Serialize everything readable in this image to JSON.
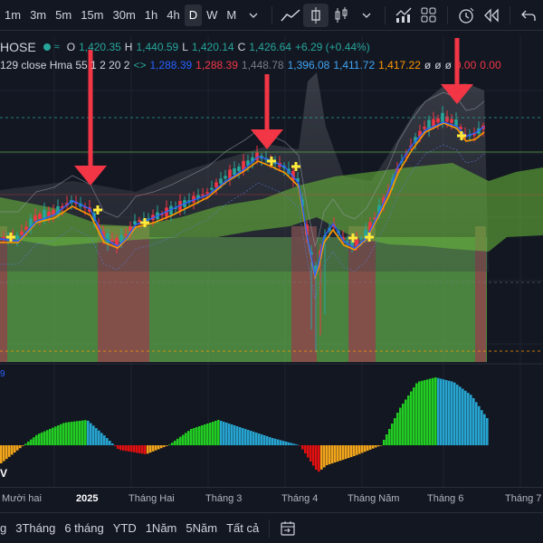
{
  "toolbar": {
    "timeframes": [
      "1m",
      "3m",
      "5m",
      "15m",
      "30m",
      "1h",
      "4h",
      "D",
      "W",
      "M"
    ],
    "active_timeframe": "D",
    "icons": [
      "chevron-down-icon",
      "line-chart-icon",
      "candle-chart-icon",
      "chevron-down-icon",
      "indicators-icon",
      "templates-icon",
      "alert-icon",
      "replay-icon",
      "undo-icon"
    ]
  },
  "legend": {
    "symbol": "HOSE",
    "open_label": "O",
    "open": "1,420.35",
    "high_label": "H",
    "high": "1,440.59",
    "low_label": "L",
    "low": "1,420.14",
    "close_label": "C",
    "close": "1,426.64",
    "change": "+6.29 (+0.44%)",
    "indicator_name": "129 close Hma 55 1 2 20 2",
    "ind_v1": "1,288.39",
    "ind_v2": "1,288.39",
    "ind_v3": "1,448.78",
    "ind_v4": "1,396.08",
    "ind_v5": "1,411.72",
    "ind_v6": "1,417.22",
    "ind_v7": "ø",
    "ind_v8": "ø",
    "ind_v9": "ø",
    "ind_v10": "0.00",
    "ind_v11": "0.00"
  },
  "oscillator": {
    "label": "9",
    "label2": "V"
  },
  "time_axis": [
    "Mười hai",
    "2025",
    "Tháng Hai",
    "Tháng 3",
    "Tháng 4",
    "Tháng Năm",
    "Tháng 6",
    "Tháng 7"
  ],
  "range_bar": [
    "3Tháng",
    "6 tháng",
    "YTD",
    "1Năm",
    "5Năm",
    "Tất cả"
  ],
  "range_bar_first": "g",
  "colors": {
    "background": "#131722",
    "up_candle": "#26a69a",
    "down_candle": "#f23645",
    "cloud_green": "#6bbf3a",
    "arrow_red": "#f23645",
    "ma_orange": "#ff9800",
    "ma_blue": "#2962ff",
    "hist_green": "#22cc22",
    "hist_blue": "#26a3cf",
    "hist_orange": "#f2a51a",
    "hist_red": "#e01010"
  }
}
